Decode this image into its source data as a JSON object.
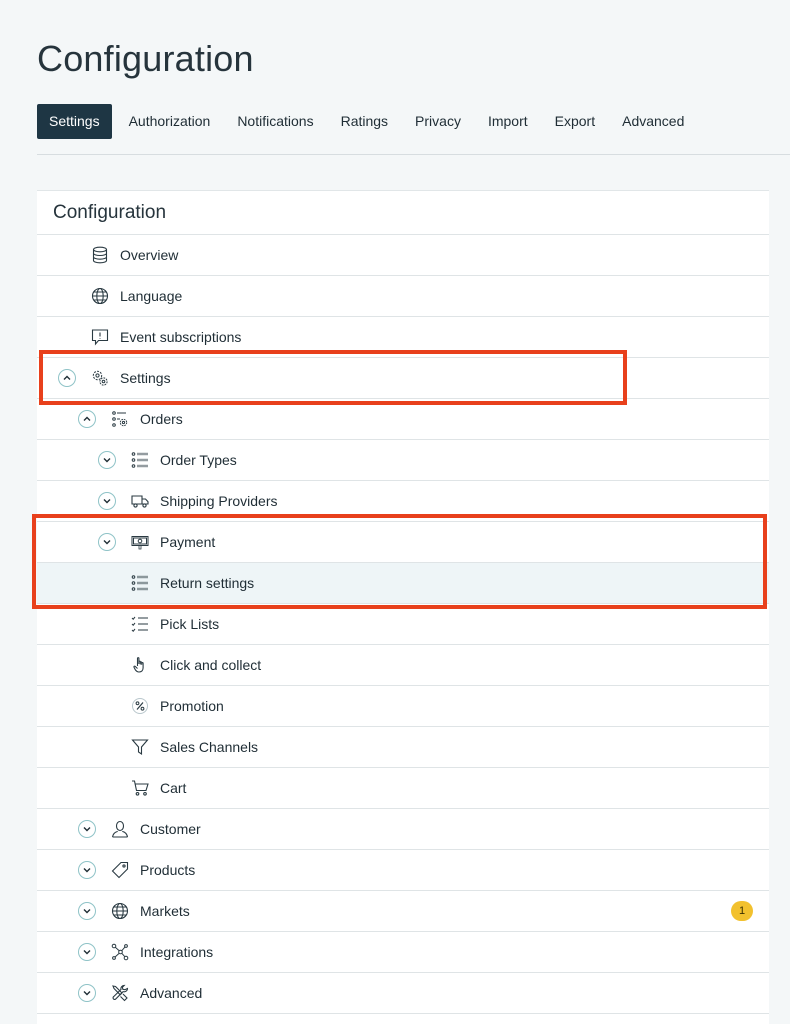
{
  "page": {
    "title": "Configuration"
  },
  "tabs": [
    {
      "label": "Settings",
      "active": true
    },
    {
      "label": "Authorization"
    },
    {
      "label": "Notifications"
    },
    {
      "label": "Ratings"
    },
    {
      "label": "Privacy"
    },
    {
      "label": "Import"
    },
    {
      "label": "Export"
    },
    {
      "label": "Advanced"
    }
  ],
  "panel": {
    "title": "Configuration",
    "items": [
      {
        "label": "Overview",
        "icon": "database-icon"
      },
      {
        "label": "Language",
        "icon": "globe-icon"
      },
      {
        "label": "Event subscriptions",
        "icon": "speech-bubble-icon"
      },
      {
        "label": "Settings",
        "icon": "gears-icon",
        "expanded": true
      },
      {
        "label": "Orders",
        "icon": "orders-list-gear-icon",
        "expanded": true
      },
      {
        "label": "Order Types",
        "icon": "list-icon",
        "expanded": false
      },
      {
        "label": "Shipping Providers",
        "icon": "truck-icon",
        "expanded": false
      },
      {
        "label": "Payment",
        "icon": "banknote-icon",
        "expanded": false
      },
      {
        "label": "Return settings",
        "icon": "list-icon",
        "selected": true
      },
      {
        "label": "Pick Lists",
        "icon": "checklist-icon"
      },
      {
        "label": "Click and collect",
        "icon": "pointer-hand-icon"
      },
      {
        "label": "Promotion",
        "icon": "percent-icon"
      },
      {
        "label": "Sales Channels",
        "icon": "funnel-icon"
      },
      {
        "label": "Cart",
        "icon": "cart-icon"
      },
      {
        "label": "Customer",
        "icon": "person-icon",
        "expanded": false
      },
      {
        "label": "Products",
        "icon": "tag-icon",
        "expanded": false
      },
      {
        "label": "Markets",
        "icon": "globe-icon",
        "expanded": false,
        "badge": "1"
      },
      {
        "label": "Integrations",
        "icon": "network-icon",
        "expanded": false
      },
      {
        "label": "Advanced",
        "icon": "tools-icon",
        "expanded": false
      }
    ]
  },
  "colors": {
    "accent": "#1e3644",
    "highlight": "#e8401c",
    "badge": "#f2c12e",
    "chevron_ring": "#8fc3c7"
  }
}
